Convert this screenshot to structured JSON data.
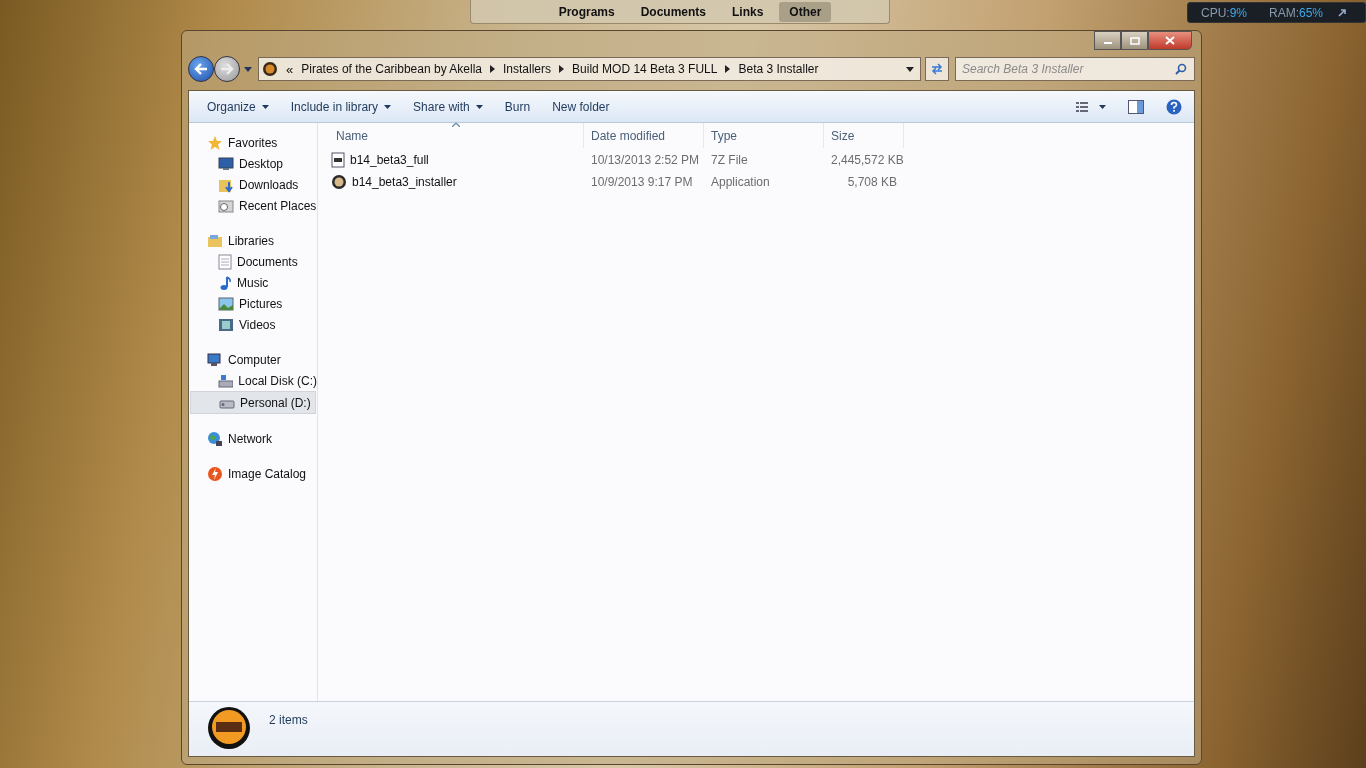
{
  "dock": {
    "tabs": [
      {
        "label": "Programs",
        "selected": false
      },
      {
        "label": "Documents",
        "selected": false
      },
      {
        "label": "Links",
        "selected": false
      },
      {
        "label": "Other",
        "selected": true
      }
    ]
  },
  "monitor": {
    "cpu_label": "CPU:",
    "cpu_value": "9%",
    "ram_label": "RAM:",
    "ram_value": "65%"
  },
  "address_bar": {
    "overflow": "«",
    "crumbs": [
      "Pirates of the Caribbean by Akella",
      "Installers",
      "Build MOD 14 Beta 3 FULL",
      "Beta 3 Installer"
    ]
  },
  "search": {
    "placeholder": "Search Beta 3 Installer"
  },
  "toolbar": {
    "buttons": [
      {
        "label": "Organize",
        "dropdown": true
      },
      {
        "label": "Include in library",
        "dropdown": true
      },
      {
        "label": "Share with",
        "dropdown": true
      },
      {
        "label": "Burn",
        "dropdown": false
      },
      {
        "label": "New folder",
        "dropdown": false
      }
    ]
  },
  "sidebar": {
    "groups": [
      {
        "label": "Favorites",
        "kind": "favorites",
        "children": [
          {
            "label": "Desktop",
            "kind": "desktop",
            "selected": false
          },
          {
            "label": "Downloads",
            "kind": "downloads",
            "selected": false
          },
          {
            "label": "Recent Places",
            "kind": "recent",
            "selected": false
          }
        ]
      },
      {
        "label": "Libraries",
        "kind": "libraries",
        "children": [
          {
            "label": "Documents",
            "kind": "documents",
            "selected": false
          },
          {
            "label": "Music",
            "kind": "music",
            "selected": false
          },
          {
            "label": "Pictures",
            "kind": "pictures",
            "selected": false
          },
          {
            "label": "Videos",
            "kind": "videos",
            "selected": false
          }
        ]
      },
      {
        "label": "Computer",
        "kind": "computer",
        "children": [
          {
            "label": "Local Disk (C:)",
            "kind": "disk",
            "selected": false
          },
          {
            "label": "Personal (D:)",
            "kind": "drive",
            "selected": true
          }
        ]
      },
      {
        "label": "Network",
        "kind": "network"
      },
      {
        "label": "Image Catalog",
        "kind": "catalog"
      }
    ]
  },
  "table": {
    "columns": [
      {
        "label": "Name",
        "sorted": true
      },
      {
        "label": "Date modified",
        "sorted": false
      },
      {
        "label": "Type",
        "sorted": false
      },
      {
        "label": "Size",
        "sorted": false
      }
    ],
    "rows": [
      {
        "kind": "archive",
        "name": "b14_beta3_full",
        "date": "10/13/2013 2:52 PM",
        "type": "7Z File",
        "size": "2,445,572 KB"
      },
      {
        "kind": "app",
        "name": "b14_beta3_installer",
        "date": "10/9/2013 9:17 PM",
        "type": "Application",
        "size": "5,708 KB"
      }
    ]
  },
  "status_bar": {
    "count": "2 items"
  }
}
